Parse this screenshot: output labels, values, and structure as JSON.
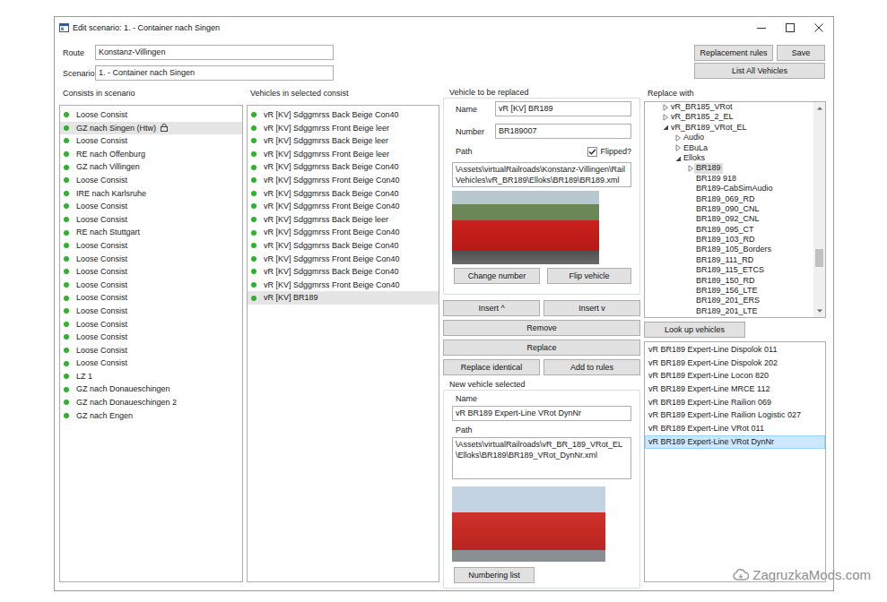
{
  "window": {
    "title": "Edit scenario: 1. - Container nach Singen"
  },
  "fields": [
    {
      "label": "Route",
      "value": "Konstanz-Villingen"
    },
    {
      "label": "Scenario",
      "value": "1. - Container nach Singen"
    }
  ],
  "top_buttons": [
    "Replacement rules",
    "Save"
  ],
  "list_all_button": "List All Vehicles",
  "consists": {
    "title": "Consists in scenario",
    "items": [
      {
        "label": "Loose Consist",
        "selected": false,
        "marked": false
      },
      {
        "label": "GZ nach Singen (Htw)",
        "selected": true,
        "marked": true
      },
      {
        "label": "Loose Consist",
        "selected": false,
        "marked": false
      },
      {
        "label": "RE nach Offenburg",
        "selected": false,
        "marked": false
      },
      {
        "label": "GZ nach Villingen",
        "selected": false,
        "marked": false
      },
      {
        "label": "Loose Consist",
        "selected": false,
        "marked": false
      },
      {
        "label": "IRE nach Karlsruhe",
        "selected": false,
        "marked": false
      },
      {
        "label": "Loose Consist",
        "selected": false,
        "marked": false
      },
      {
        "label": "Loose Consist",
        "selected": false,
        "marked": false
      },
      {
        "label": "RE nach Stuttgart",
        "selected": false,
        "marked": false
      },
      {
        "label": "Loose Consist",
        "selected": false,
        "marked": false
      },
      {
        "label": "Loose Consist",
        "selected": false,
        "marked": false
      },
      {
        "label": "Loose Consist",
        "selected": false,
        "marked": false
      },
      {
        "label": "Loose Consist",
        "selected": false,
        "marked": false
      },
      {
        "label": "Loose Consist",
        "selected": false,
        "marked": false
      },
      {
        "label": "Loose Consist",
        "selected": false,
        "marked": false
      },
      {
        "label": "Loose Consist",
        "selected": false,
        "marked": false
      },
      {
        "label": "Loose Consist",
        "selected": false,
        "marked": false
      },
      {
        "label": "Loose Consist",
        "selected": false,
        "marked": false
      },
      {
        "label": "Loose Consist",
        "selected": false,
        "marked": false
      },
      {
        "label": "LZ 1",
        "selected": false,
        "marked": false
      },
      {
        "label": "GZ nach Donaueschingen",
        "selected": false,
        "marked": false
      },
      {
        "label": "GZ nach Donaueschingen 2",
        "selected": false,
        "marked": false
      },
      {
        "label": "GZ nach Engen",
        "selected": false,
        "marked": false
      }
    ]
  },
  "vehicles": {
    "title": "Vehicles in selected consist",
    "items": [
      {
        "label": "vR [KV] Sdggmrss Back Beige Con40",
        "selected": false
      },
      {
        "label": "vR [KV] Sdggmrss Front Beige leer",
        "selected": false
      },
      {
        "label": "vR [KV] Sdggmrss Back Beige leer",
        "selected": false
      },
      {
        "label": "vR [KV] Sdggmrss Front Beige leer",
        "selected": false
      },
      {
        "label": "vR [KV] Sdggmrss Back Beige Con40",
        "selected": false
      },
      {
        "label": "vR [KV] Sdggmrss Front Beige Con40",
        "selected": false
      },
      {
        "label": "vR [KV] Sdggmrss Back Beige Con40",
        "selected": false
      },
      {
        "label": "vR [KV] Sdggmrss Front Beige Con40",
        "selected": false
      },
      {
        "label": "vR [KV] Sdggmrss Back Beige leer",
        "selected": false
      },
      {
        "label": "vR [KV] Sdggmrss Front Beige Con40",
        "selected": false
      },
      {
        "label": "vR [KV] Sdggmrss Back Beige Con40",
        "selected": false
      },
      {
        "label": "vR [KV] Sdggmrss Front Beige Con40",
        "selected": false
      },
      {
        "label": "vR [KV] Sdggmrss Back Beige Con40",
        "selected": false
      },
      {
        "label": "vR [KV] Sdggmrss Front Beige Con40",
        "selected": false
      },
      {
        "label": "vR [KV] BR189",
        "selected": true
      }
    ]
  },
  "old_vehicle": {
    "title": "Vehicle to be replaced",
    "name_label": "Name",
    "name": "vR [KV] BR189",
    "number_label": "Number",
    "number": "BR189007",
    "path_label": "Path",
    "flipped_label": "Flipped?",
    "flipped": true,
    "path": "\\Assets\\virtualRailroads\\Konstanz-Villingen\\RailVehicles\\vR_BR189\\Elloks\\BR189\\BR189.xml",
    "buttons": [
      "Change number",
      "Flip vehicle"
    ]
  },
  "actions": {
    "insert_up": "Insert ^",
    "insert_down": "Insert v",
    "remove": "Remove",
    "replace": "Replace",
    "replace_identical": "Replace identical",
    "add_to_rules": "Add to rules"
  },
  "new_vehicle": {
    "title": "New vehicle selected",
    "name_label": "Name",
    "name": "vR BR189 Expert-Line VRot DynNr",
    "path_label": "Path",
    "path": "\\Assets\\virtualRailroads\\vR_BR_189_VRot_EL\\Elloks\\BR189\\BR189_VRot_DynNr.xml",
    "button": "Numbering list"
  },
  "replace_with": {
    "title": "Replace with",
    "scroll_position": 0.78,
    "tree": [
      {
        "label": "vR_BR185_VRot",
        "depth": 0,
        "expandable": true,
        "expanded": false,
        "selected": false
      },
      {
        "label": "vR_BR185_2_EL",
        "depth": 0,
        "expandable": true,
        "expanded": false,
        "selected": false
      },
      {
        "label": "vR_BR189_VRot_EL",
        "depth": 0,
        "expandable": true,
        "expanded": true,
        "selected": false
      },
      {
        "label": "Audio",
        "depth": 1,
        "expandable": true,
        "expanded": false,
        "selected": false
      },
      {
        "label": "EBuLa",
        "depth": 1,
        "expandable": true,
        "expanded": false,
        "selected": false
      },
      {
        "label": "Elloks",
        "depth": 1,
        "expandable": true,
        "expanded": true,
        "selected": false
      },
      {
        "label": "BR189",
        "depth": 2,
        "expandable": true,
        "expanded": false,
        "selected": true
      },
      {
        "label": "BR189 918",
        "depth": 2,
        "expandable": false,
        "expanded": false,
        "selected": false
      },
      {
        "label": "BR189-CabSimAudio",
        "depth": 2,
        "expandable": false,
        "expanded": false,
        "selected": false
      },
      {
        "label": "BR189_069_RD",
        "depth": 2,
        "expandable": false,
        "expanded": false,
        "selected": false
      },
      {
        "label": "BR189_090_CNL",
        "depth": 2,
        "expandable": false,
        "expanded": false,
        "selected": false
      },
      {
        "label": "BR189_092_CNL",
        "depth": 2,
        "expandable": false,
        "expanded": false,
        "selected": false
      },
      {
        "label": "BR189_095_CT",
        "depth": 2,
        "expandable": false,
        "expanded": false,
        "selected": false
      },
      {
        "label": "BR189_103_RD",
        "depth": 2,
        "expandable": false,
        "expanded": false,
        "selected": false
      },
      {
        "label": "BR189_105_Borders",
        "depth": 2,
        "expandable": false,
        "expanded": false,
        "selected": false
      },
      {
        "label": "BR189_111_RD",
        "depth": 2,
        "expandable": false,
        "expanded": false,
        "selected": false
      },
      {
        "label": "BR189_115_ETCS",
        "depth": 2,
        "expandable": false,
        "expanded": false,
        "selected": false
      },
      {
        "label": "BR189_150_RD",
        "depth": 2,
        "expandable": false,
        "expanded": false,
        "selected": false
      },
      {
        "label": "BR189_156_LTE",
        "depth": 2,
        "expandable": false,
        "expanded": false,
        "selected": false
      },
      {
        "label": "BR189_201_ERS",
        "depth": 2,
        "expandable": false,
        "expanded": false,
        "selected": false
      },
      {
        "label": "BR189_201_LTE",
        "depth": 2,
        "expandable": false,
        "expanded": false,
        "selected": false
      }
    ],
    "lookup_button": "Look up vehicles",
    "results": [
      {
        "label": "vR BR189 Expert-Line Dispolok 011",
        "selected": false
      },
      {
        "label": "vR BR189 Expert-Line Dispolok 202",
        "selected": false
      },
      {
        "label": "vR BR189 Expert-Line Locon 820",
        "selected": false
      },
      {
        "label": "vR BR189 Expert-Line MRCE 112",
        "selected": false
      },
      {
        "label": "vR BR189 Expert-Line Railion 069",
        "selected": false
      },
      {
        "label": "vR BR189 Expert-Line Railion Logistic 027",
        "selected": false
      },
      {
        "label": "vR BR189 Expert-Line VRot 011",
        "selected": false
      },
      {
        "label": "vR BR189 Expert-Line VRot DynNr",
        "selected": true
      }
    ]
  },
  "watermark": "ZagruzkaMods.com"
}
